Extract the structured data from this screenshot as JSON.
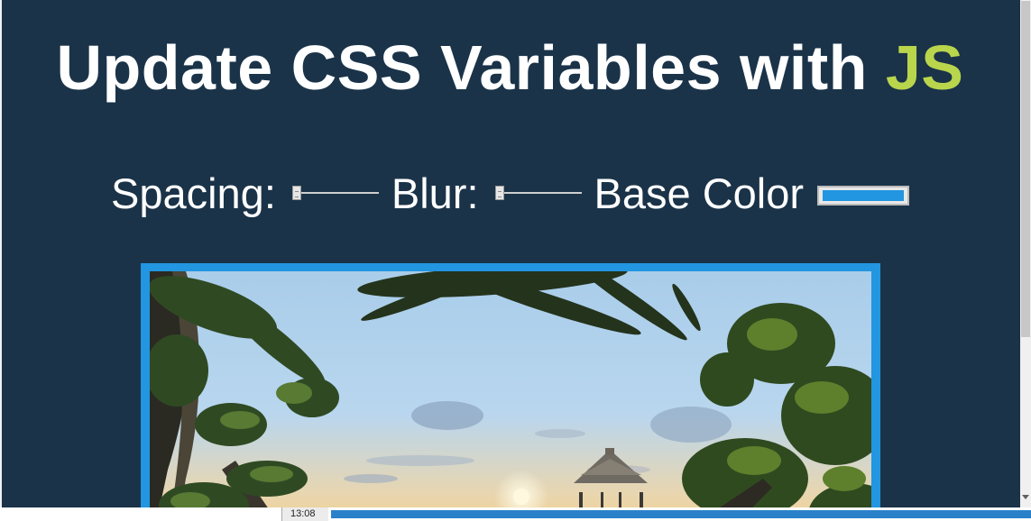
{
  "title": {
    "prefix": "Update CSS Variables with ",
    "highlight": "JS"
  },
  "controls": {
    "spacing_label": "Spacing:",
    "spacing_value": 0,
    "blur_label": "Blur:",
    "blur_value": 0,
    "base_color_label": "Base Color",
    "base_color": "#2296e0"
  },
  "colors": {
    "background": "#1a3349",
    "accent_text": "#b9d54c",
    "base": "#2296e0"
  },
  "status": {
    "time": "13:08",
    "progress": 1.0
  }
}
